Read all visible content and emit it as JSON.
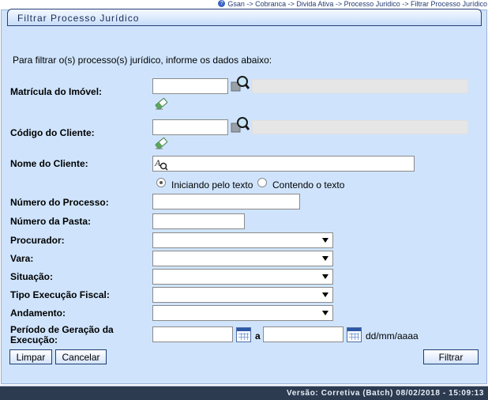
{
  "breadcrumb": "Gsan -> Cobranca -> Divida Ativa -> Processo Juridico -> Filtrar Processo Jurídico",
  "panel_title": "Filtrar Processo Jurídico",
  "instructions": "Para filtrar o(s) processo(s) jurídico, informe os dados abaixo:",
  "fields": {
    "matricula": {
      "label": "Matrícula do Imóvel:",
      "value": ""
    },
    "codigo_cliente": {
      "label": "Código do Cliente:",
      "value": ""
    },
    "nome_cliente": {
      "label": "Nome do Cliente:",
      "value": ""
    },
    "numero_processo": {
      "label": "Número do Processo:",
      "value": ""
    },
    "numero_pasta": {
      "label": "Número da Pasta:",
      "value": ""
    },
    "procurador": {
      "label": "Procurador:",
      "value": ""
    },
    "vara": {
      "label": "Vara:",
      "value": ""
    },
    "situacao": {
      "label": "Situação:",
      "value": ""
    },
    "tipo_execucao": {
      "label": "Tipo Execução Fiscal:",
      "value": ""
    },
    "andamento": {
      "label": "Andamento:",
      "value": ""
    },
    "periodo": {
      "label_line1": "Período de Geração da",
      "label_line2": "Execução:",
      "from": "",
      "to": "",
      "separator": "a",
      "format_hint": "dd/mm/aaaa"
    }
  },
  "radio": {
    "starts_with": "Iniciando pelo texto",
    "contains": "Contendo o texto",
    "selected": "starts_with"
  },
  "buttons": {
    "limpar": "Limpar",
    "cancelar": "Cancelar",
    "filtrar": "Filtrar"
  },
  "footer": "Versão: Corretiva (Batch) 08/02/2018 - 15:09:13",
  "icons": {
    "help": "help-icon",
    "search": "magnifier-icon",
    "clear": "eraser-icon",
    "text_search": "text-search-icon",
    "calendar": "calendar-icon"
  }
}
